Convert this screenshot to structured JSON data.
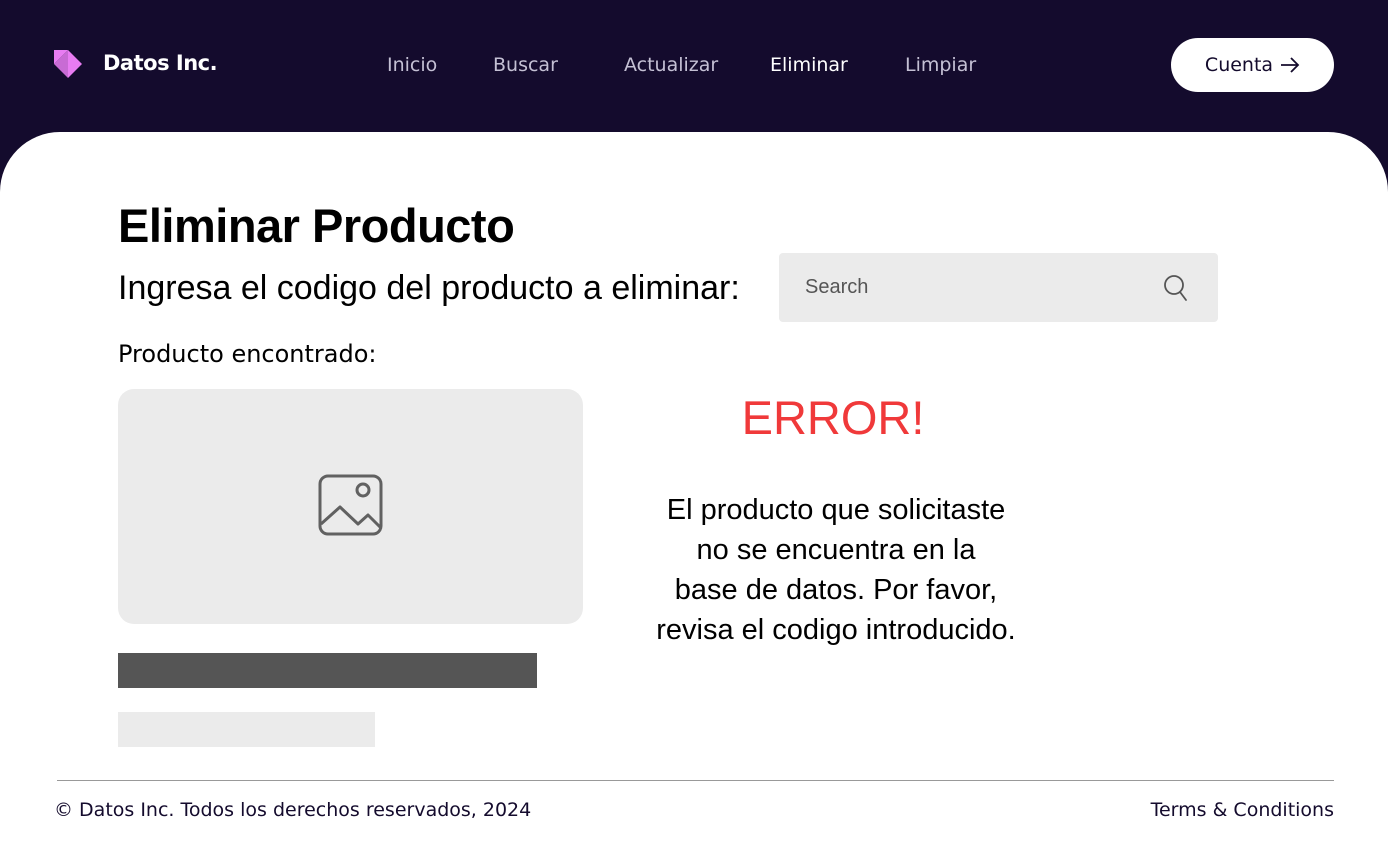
{
  "brand": {
    "name": "Datos Inc.",
    "logo_icon": "triangles-logo-icon",
    "logo_color": "#e87cf2"
  },
  "nav": {
    "items": [
      {
        "label": "Inicio"
      },
      {
        "label": "Buscar"
      },
      {
        "label": "Actualizar"
      },
      {
        "label": "Eliminar",
        "active": true
      },
      {
        "label": "Limpiar"
      }
    ],
    "account_label": "Cuenta",
    "account_icon": "arrow-right-icon"
  },
  "main": {
    "title": "Eliminar Producto",
    "prompt": "Ingresa el codigo del producto a eliminar:",
    "search": {
      "placeholder": "Search",
      "value": "",
      "icon": "search-icon"
    },
    "found_label": "Producto encontrado:",
    "image_icon": "image-icon",
    "error": {
      "title": "ERROR!",
      "lines": [
        "El producto que solicitaste",
        "no se encuentra en la",
        "base de datos. Por favor,",
        "revisa el codigo introducido."
      ]
    }
  },
  "footer": {
    "copyright": "© Datos Inc. Todos los derechos reservados, 2024",
    "terms": "Terms & Conditions"
  },
  "colors": {
    "header_bg": "#140b2d",
    "error": "#f0393a",
    "placeholder_bg": "#ebebeb",
    "bar_dark": "#555555"
  }
}
